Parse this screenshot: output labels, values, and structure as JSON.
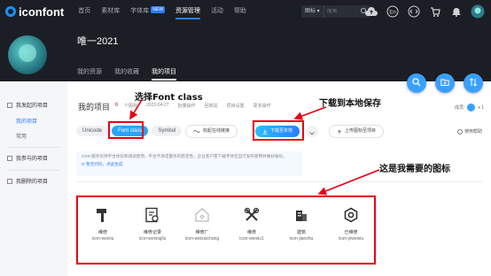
{
  "nav": {
    "logo": "iconfont",
    "items": [
      "首页",
      "素材库",
      "字体库",
      "资源管理",
      "活动",
      "帮助"
    ],
    "new_badge": "NEW",
    "search_select": "图标",
    "search_placeholder": "搜索"
  },
  "header": {
    "username": "唯一2021",
    "tabs": [
      "我的资源",
      "我的收藏",
      "我的项目"
    ]
  },
  "sidebar": {
    "group1": "我发起的项目",
    "items": [
      "我的项目",
      "常用"
    ],
    "group2": "我参与的项目",
    "group3": "我删除的项目"
  },
  "project": {
    "title": "我的项目",
    "count": "6",
    "meta": [
      "个图标",
      "2023-04-27",
      "批量操作",
      "回收站",
      "项目设置",
      "更多操作"
    ],
    "members_label": "成员:",
    "members_count": "x 1"
  },
  "tabs": [
    "Unicode",
    "Font class",
    "Symbol"
  ],
  "actions": {
    "online_link": "收起在线链接",
    "download": "下载至本地",
    "upload": "上传图标至项目",
    "help": "使用帮助"
  },
  "notice": {
    "text": "CDN 服务仅供平台体验和调试使用，平台不承诺服务的稳定性，企业客户需下载字体包自行发布使用并做好备份。",
    "link": "暂无代码，点此生成"
  },
  "icons": [
    {
      "name": "维修",
      "class": "icon-weixiu",
      "glyph": "hammer-icon"
    },
    {
      "name": "维修记录",
      "class": "icon-weixiujilu",
      "glyph": "repair-record-icon"
    },
    {
      "name": "维修厂",
      "class": "icon-weixiuchang",
      "glyph": "factory-icon"
    },
    {
      "name": "维修",
      "class": "icon-weixiu1",
      "glyph": "tools-icon"
    },
    {
      "name": "建筑",
      "class": "icon-jianzhu",
      "glyph": "building-icon"
    },
    {
      "name": "已维修",
      "class": "icon-yiweixiu",
      "glyph": "repaired-icon"
    }
  ],
  "annotations": {
    "font_class": "选择Font class",
    "download": "下载到本地保存",
    "icons": "这是我需要的图标"
  },
  "colors": {
    "accent": "#2b7cff",
    "annotation": "#e60012",
    "nav_bg": "#1b1e24"
  }
}
